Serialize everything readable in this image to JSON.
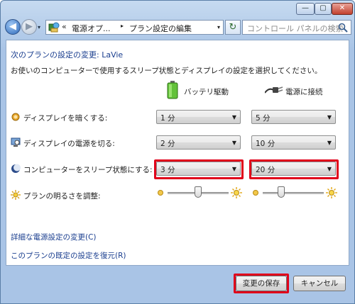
{
  "titlebar": {
    "min": "—",
    "max": "▢",
    "close": "✕"
  },
  "nav": {
    "back_glyph": "◀",
    "forward_glyph": "▶",
    "dropdown_glyph": "▾",
    "breadcrumb_prefix": "«",
    "breadcrumb": [
      "電源オプ...",
      "プラン設定の編集"
    ],
    "breadcrumb_sep": "▸",
    "address_dropdown": "▾",
    "refresh_glyph": "↻",
    "search_placeholder": "コントロール パネルの検索"
  },
  "main": {
    "plan_title": "次のプランの設定の変更: LaVie",
    "description": "お使いのコンピューターで使用するスリープ状態とディスプレイの設定を選択してください。",
    "columns": {
      "battery": "バッテリ駆動",
      "plugged": "電源に接続"
    },
    "rows": [
      {
        "label": "ディスプレイを暗くする:",
        "battery": "1 分",
        "plugged": "5 分"
      },
      {
        "label": "ディスプレイの電源を切る:",
        "battery": "2 分",
        "plugged": "10 分"
      },
      {
        "label": "コンピューターをスリープ状態にする:",
        "battery": "3 分",
        "plugged": "20 分"
      }
    ],
    "brightness": {
      "label": "プランの明るさを調整:",
      "battery_level": 0.5,
      "plugged_level": 0.3
    },
    "select_arrow": "▼",
    "links": {
      "advanced": "詳細な電源設定の変更(C)",
      "restore": "このプランの既定の設定を復元(R)"
    }
  },
  "footer": {
    "save": "変更の保存",
    "cancel": "キャンセル"
  },
  "colors": {
    "highlight": "#e0001a",
    "link": "#1a3e8f"
  }
}
